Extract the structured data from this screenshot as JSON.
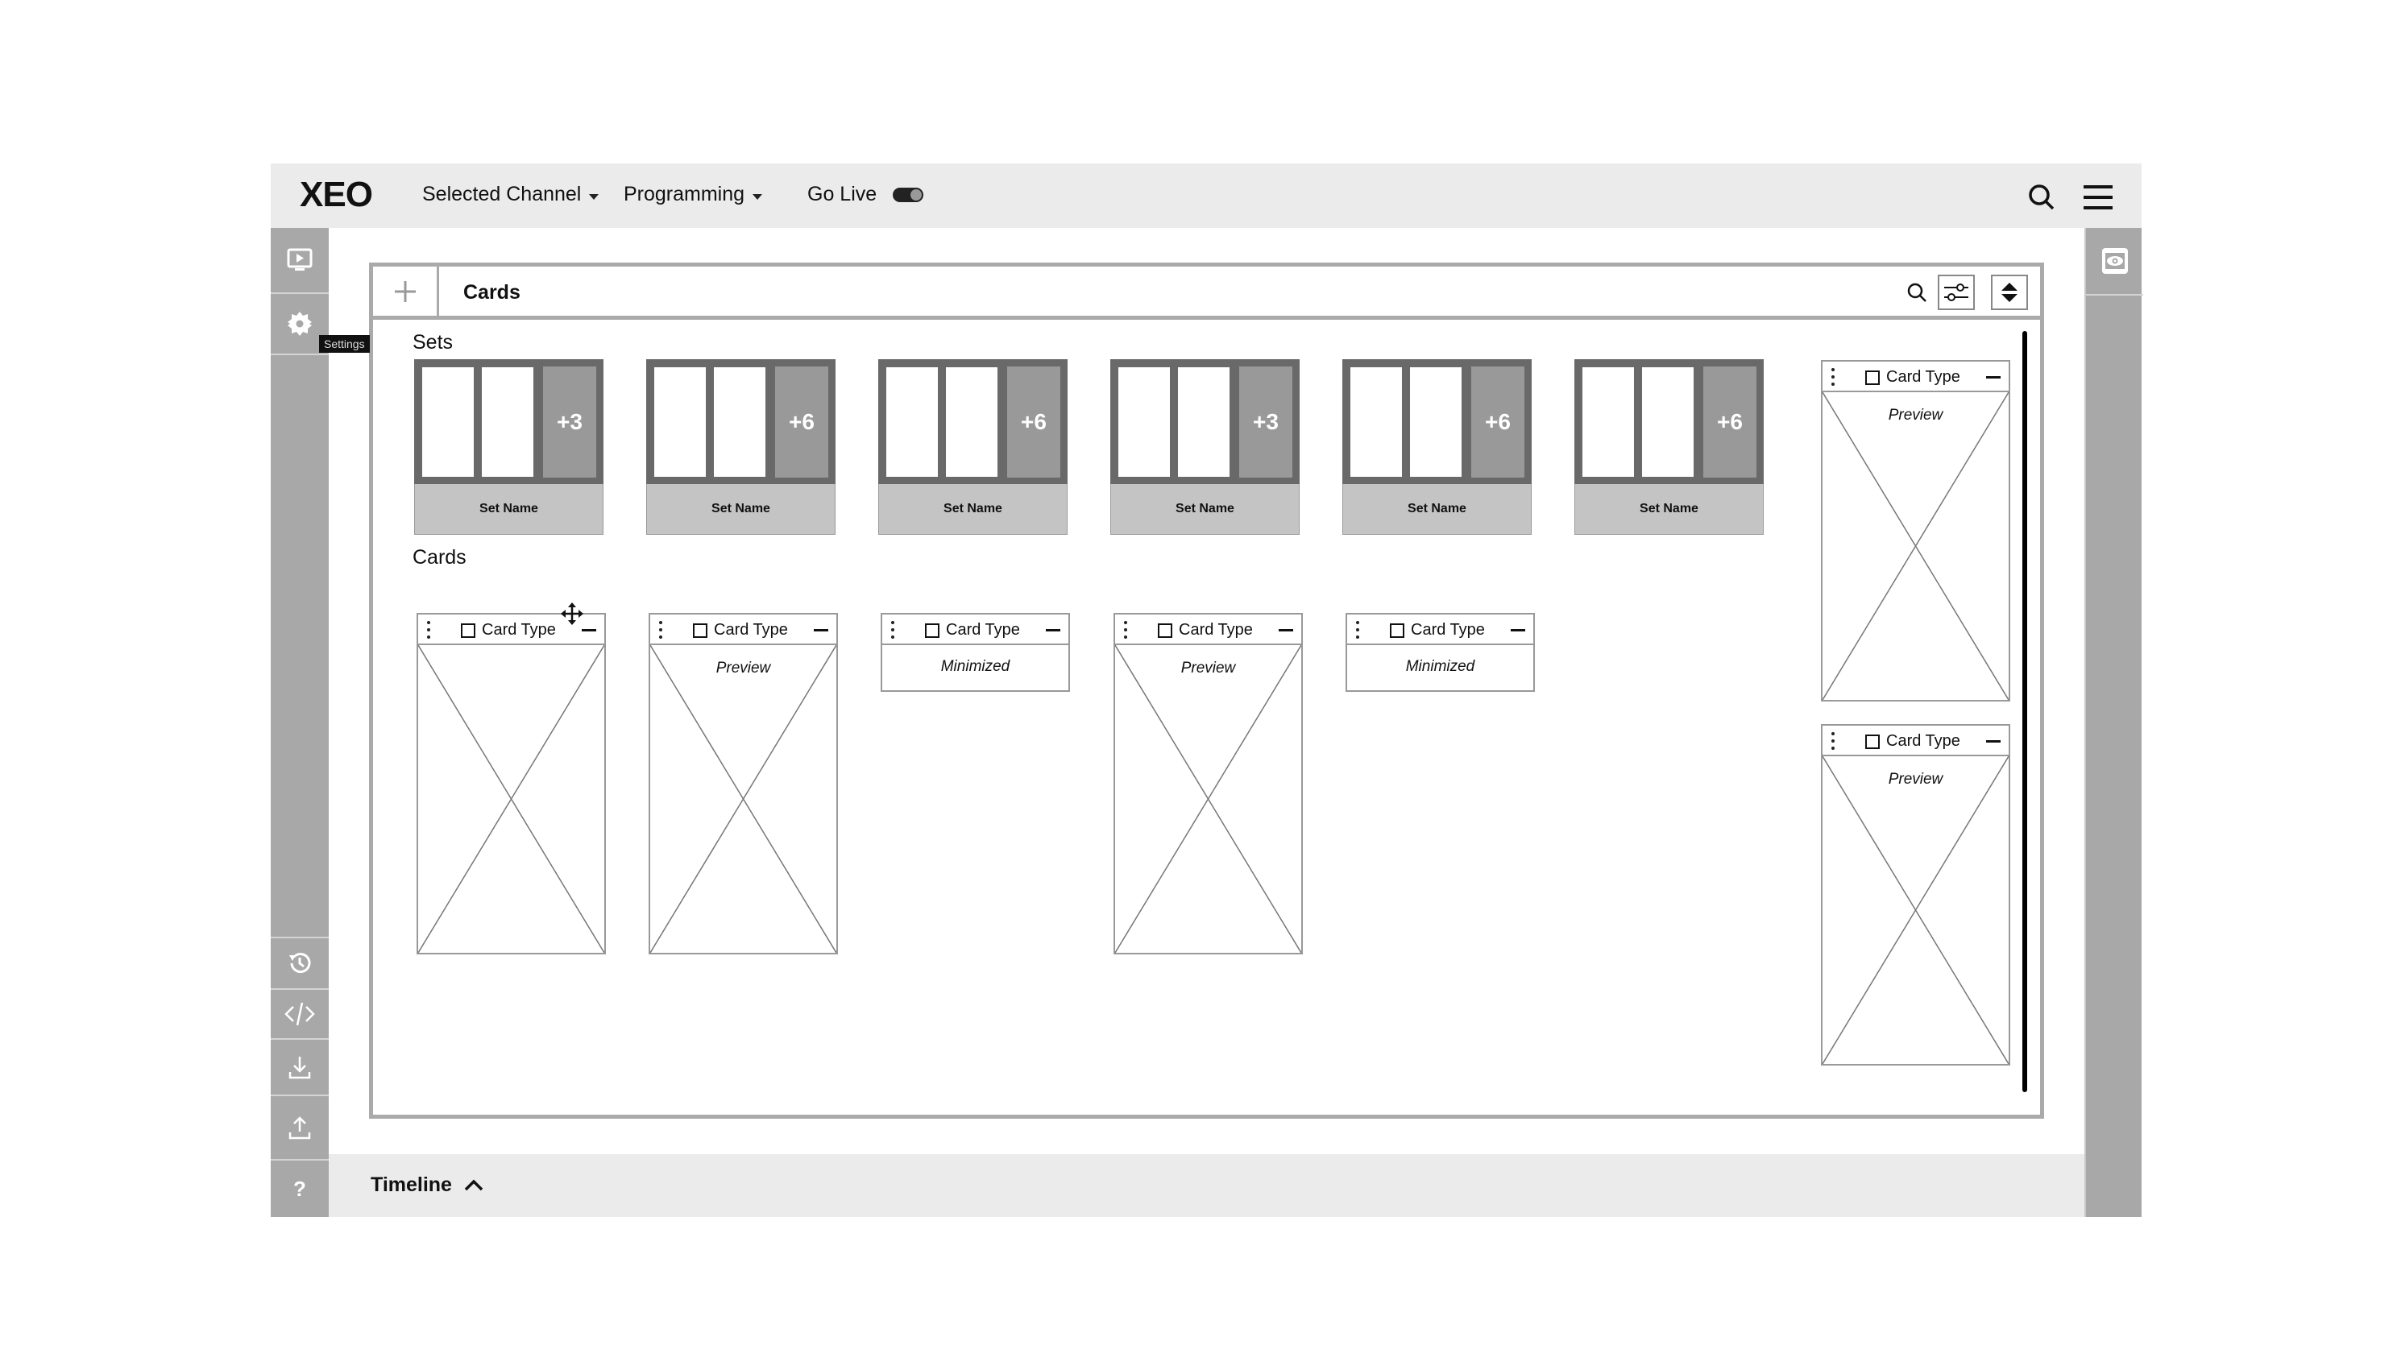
{
  "topbar": {
    "logo": "XEO",
    "nav": [
      {
        "label": "Selected Channel",
        "has_dropdown": true
      },
      {
        "label": "Programming",
        "has_dropdown": true
      }
    ],
    "go_live": {
      "label": "Go Live",
      "toggle_on": true
    },
    "icons": [
      "search-icon",
      "hamburger-menu-icon"
    ]
  },
  "left_sidebar": {
    "top_items": [
      {
        "icon": "play-screen-icon",
        "label": "Preview"
      },
      {
        "icon": "gear-icon",
        "label": "Settings"
      }
    ],
    "tooltip": "Settings",
    "bottom_items": [
      {
        "icon": "history-icon"
      },
      {
        "icon": "code-icon"
      },
      {
        "icon": "download-icon"
      },
      {
        "icon": "upload-icon"
      },
      {
        "icon": "help-icon",
        "glyph": "?"
      }
    ]
  },
  "right_sidebar": {
    "items": [
      {
        "icon": "eye-icon"
      }
    ]
  },
  "panel": {
    "add_icon": "+",
    "title": "Cards",
    "header_icons": [
      "search-icon",
      "sliders-icon",
      "sort-icon"
    ],
    "sets_label": "Sets",
    "cards_label": "Cards",
    "sets": [
      {
        "name": "Set Name",
        "more": "+3"
      },
      {
        "name": "Set Name",
        "more": "+6"
      },
      {
        "name": "Set Name",
        "more": "+6"
      },
      {
        "name": "Set Name",
        "more": "+3"
      },
      {
        "name": "Set Name",
        "more": "+6"
      },
      {
        "name": "Set Name",
        "more": "+6"
      }
    ],
    "cards": [
      {
        "type": "Card Type",
        "state": "",
        "mode": "image"
      },
      {
        "type": "Card Type",
        "state": "Preview",
        "mode": "image"
      },
      {
        "type": "Card Type",
        "state": "Minimized",
        "mode": "minimized"
      },
      {
        "type": "Card Type",
        "state": "Preview",
        "mode": "image"
      },
      {
        "type": "Card Type",
        "state": "Minimized",
        "mode": "minimized"
      }
    ],
    "side_cards": [
      {
        "type": "Card Type",
        "state": "Preview",
        "mode": "image"
      },
      {
        "type": "Card Type",
        "state": "Preview",
        "mode": "image"
      }
    ]
  },
  "timeline": {
    "label": "Timeline",
    "expanded": false
  }
}
